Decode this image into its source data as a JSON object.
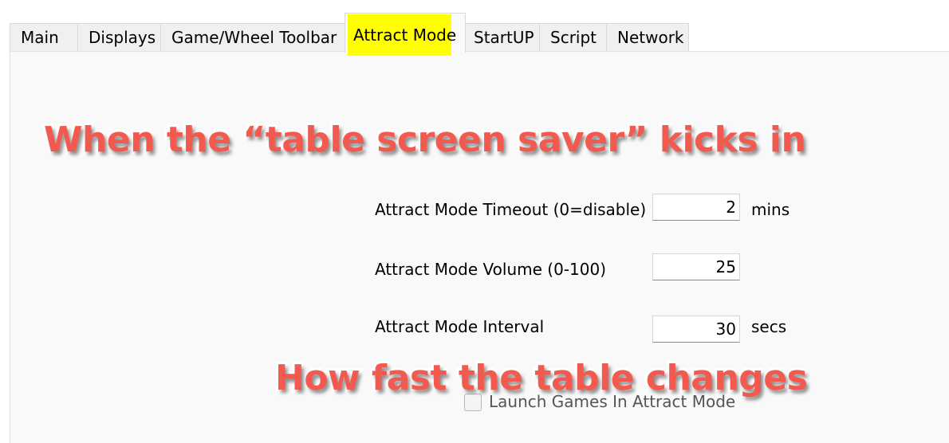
{
  "tabs": [
    {
      "label": "Main"
    },
    {
      "label": "Displays"
    },
    {
      "label": "Game/Wheel Toolbar"
    },
    {
      "label": "Attract Mode",
      "active": true,
      "highlight_color": "#ffff00"
    },
    {
      "label": "StartUP"
    },
    {
      "label": "Script"
    },
    {
      "label": "Network"
    }
  ],
  "settings": {
    "timeout": {
      "label": "Attract Mode Timeout (0=disable)",
      "value": "2",
      "unit": "mins"
    },
    "volume": {
      "label": "Attract Mode Volume (0-100)",
      "value": "25"
    },
    "interval": {
      "label": "Attract Mode Interval",
      "value": "30",
      "unit": "secs"
    },
    "launch_games": {
      "label": "Launch Games In Attract Mode",
      "checked": false
    }
  },
  "annotations": {
    "top": "When the “table screen saver” kicks in",
    "bottom": "How fast the table changes",
    "color": "#f25a4f"
  }
}
